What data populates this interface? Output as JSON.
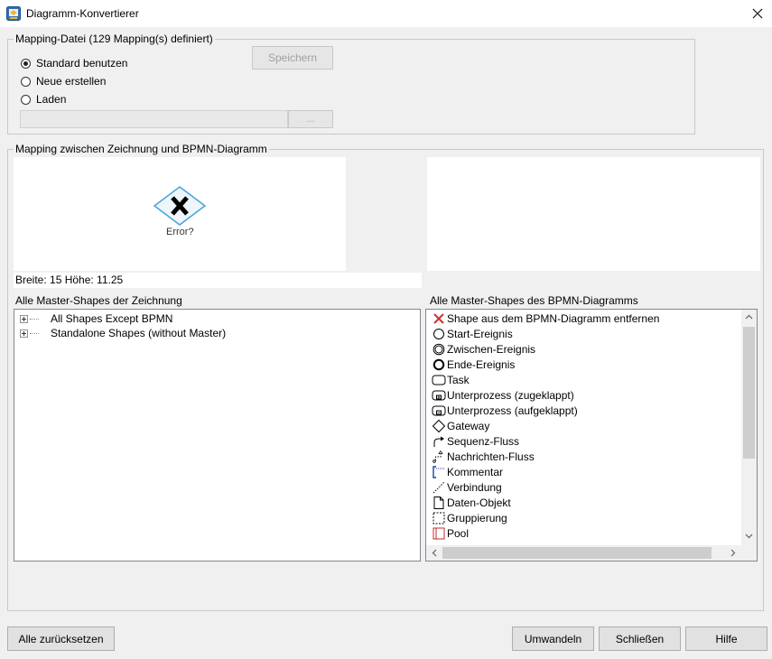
{
  "window": {
    "title": "Diagramm-Konvertierer"
  },
  "mapping_file": {
    "legend": "Mapping-Datei (129 Mapping(s) definiert)",
    "options": [
      {
        "label": "Standard benutzen",
        "checked": true
      },
      {
        "label": "Neue erstellen",
        "checked": false
      },
      {
        "label": "Laden",
        "checked": false
      }
    ],
    "save_label": "Speichern",
    "path_value": "",
    "browse_label": "..."
  },
  "mapping": {
    "legend": "Mapping zwischen Zeichnung und BPMN-Diagramm",
    "preview_caption": "Error?",
    "dimensions": "Breite: 15 Höhe: 11.25",
    "left_list_label": "Alle Master-Shapes der Zeichnung",
    "left_items": [
      {
        "label": "All Shapes Except BPMN"
      },
      {
        "label": "Standalone Shapes (without Master)"
      }
    ],
    "right_list_label": "Alle Master-Shapes des BPMN-Diagramms",
    "right_items": [
      {
        "label": "Shape aus dem BPMN-Diagramm entfernen",
        "icon": "red-x-icon"
      },
      {
        "label": "Start-Ereignis",
        "icon": "start-event-icon"
      },
      {
        "label": "Zwischen-Ereignis",
        "icon": "intermediate-event-icon"
      },
      {
        "label": "Ende-Ereignis",
        "icon": "end-event-icon"
      },
      {
        "label": "Task",
        "icon": "task-icon"
      },
      {
        "label": "Unterprozess (zugeklappt)",
        "icon": "subprocess-collapsed-icon"
      },
      {
        "label": "Unterprozess (aufgeklappt)",
        "icon": "subprocess-expanded-icon"
      },
      {
        "label": "Gateway",
        "icon": "gateway-icon"
      },
      {
        "label": "Sequenz-Fluss",
        "icon": "sequence-flow-icon"
      },
      {
        "label": "Nachrichten-Fluss",
        "icon": "message-flow-icon"
      },
      {
        "label": "Kommentar",
        "icon": "annotation-icon"
      },
      {
        "label": "Verbindung",
        "icon": "association-icon"
      },
      {
        "label": "Daten-Objekt",
        "icon": "data-object-icon"
      },
      {
        "label": "Gruppierung",
        "icon": "group-icon"
      },
      {
        "label": "Pool",
        "icon": "pool-icon"
      }
    ]
  },
  "footer": {
    "reset_label": "Alle zurücksetzen",
    "convert_label": "Umwandeln",
    "close_label": "Schließen",
    "help_label": "Hilfe"
  },
  "colors": {
    "accent_red": "#d32f2f",
    "pool_red": "#c62828",
    "annotation_blue": "#1f3f9f"
  }
}
